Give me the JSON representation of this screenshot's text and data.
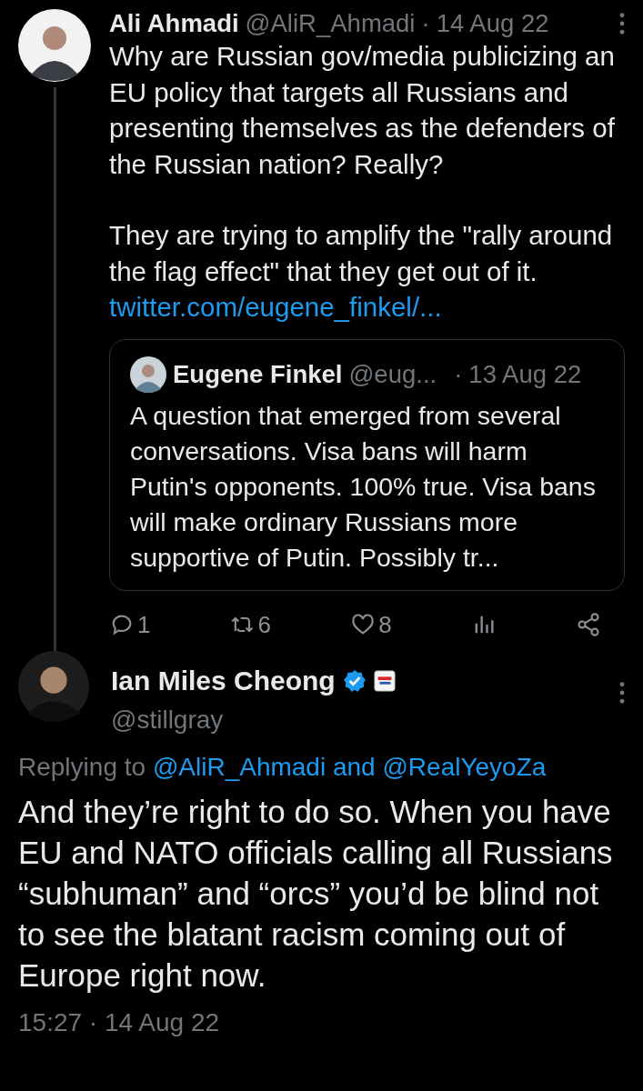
{
  "parent_tweet": {
    "name": "Ali Ahmadi",
    "handle": "@AliR_Ahmadi",
    "separator": "·",
    "date": "14 Aug 22",
    "paragraphs": [
      "Why are Russian gov/media publicizing an EU policy that targets all Russians and presenting themselves as the defenders of the Russian nation? Really?",
      "They are trying to amplify the \"rally around the flag effect\" that they get out of it."
    ],
    "link": "twitter.com/eugene_finkel/...",
    "quote": {
      "name": "Eugene Finkel",
      "handle": "@eug...",
      "separator": "·",
      "date": "13 Aug 22",
      "text": "A question that emerged from several conversations. Visa bans will harm Putin's opponents. 100% true. Visa bans will make ordinary Russians more supportive of Putin. Possibly tr..."
    },
    "actions": [
      {
        "kind": "reply",
        "count": "1"
      },
      {
        "kind": "retweet",
        "count": "6"
      },
      {
        "kind": "like",
        "count": "8"
      },
      {
        "kind": "views"
      },
      {
        "kind": "share"
      }
    ]
  },
  "main_tweet": {
    "name": "Ian Miles Cheong",
    "verified": true,
    "handle": "@stillgray",
    "replying_label": "Replying to",
    "replying_to": "@AliR_Ahmadi and @RealYeyoZa",
    "text": "And they’re right to do so. When you have EU and NATO officials calling all Russians “subhuman” and “orcs” you’d be blind not to see the blatant racism coming out of Europe right now.",
    "timestamp": "15:27 · 14 Aug 22"
  }
}
